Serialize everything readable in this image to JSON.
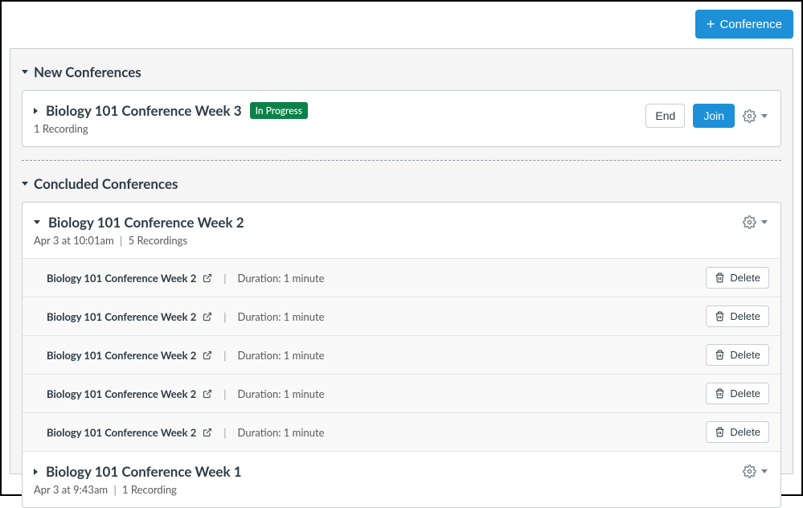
{
  "topbar": {
    "new_conf_label": "Conference"
  },
  "sections": {
    "new_header": "New Conferences",
    "concluded_header": "Concluded Conferences"
  },
  "new_conference": {
    "title": "Biology 101 Conference Week 3",
    "badge": "In Progress",
    "sub": "1 Recording",
    "end_label": "End",
    "join_label": "Join"
  },
  "concluded": [
    {
      "title": "Biology 101 Conference Week 2",
      "date": "Apr 3 at 10:01am",
      "rec_count": "5 Recordings",
      "recordings": [
        {
          "title": "Biology 101 Conference Week 2",
          "duration": "Duration: 1 minute"
        },
        {
          "title": "Biology 101 Conference Week 2",
          "duration": "Duration: 1 minute"
        },
        {
          "title": "Biology 101 Conference Week 2",
          "duration": "Duration: 1 minute"
        },
        {
          "title": "Biology 101 Conference Week 2",
          "duration": "Duration: 1 minute"
        },
        {
          "title": "Biology 101 Conference Week 2",
          "duration": "Duration: 1 minute"
        }
      ]
    },
    {
      "title": "Biology 101 Conference Week 1",
      "date": "Apr 3 at 9:43am",
      "rec_count": "1 Recording"
    }
  ],
  "labels": {
    "delete": "Delete"
  }
}
